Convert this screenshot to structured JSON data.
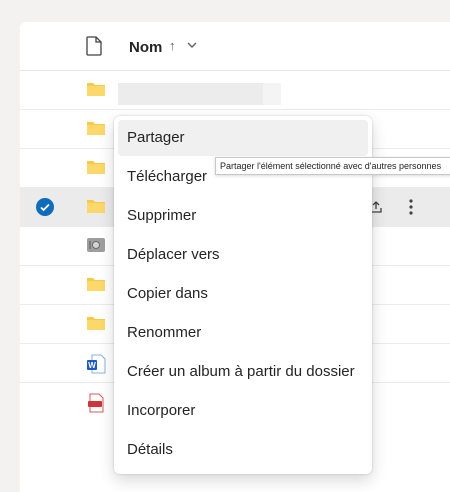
{
  "header": {
    "name_label": "Nom",
    "sort_arrow": "↑",
    "file_column_icon": "file-icon",
    "sort_menu_icon": "chevron-down-icon"
  },
  "rows": [
    {
      "icon": "folder-icon",
      "selected": false
    },
    {
      "icon": "folder-icon",
      "selected": false
    },
    {
      "icon": "folder-icon",
      "selected": false
    },
    {
      "icon": "folder-icon",
      "selected": true
    },
    {
      "icon": "vault-icon",
      "selected": false
    },
    {
      "icon": "folder-icon",
      "selected": false
    },
    {
      "icon": "folder-icon",
      "selected": false
    },
    {
      "icon": "word-doc-icon",
      "selected": false
    },
    {
      "icon": "pdf-icon",
      "selected": false
    }
  ],
  "row_actions": {
    "share_icon": "share-icon",
    "more_icon": "more-vertical-icon"
  },
  "context_menu": {
    "items": [
      "Partager",
      "Télécharger",
      "Supprimer",
      "Déplacer vers",
      "Copier dans",
      "Renommer",
      "Créer un album à partir du dossier",
      "Incorporer",
      "Détails"
    ],
    "hovered_index": 0
  },
  "tooltip": {
    "text": "Partager l'élément sélectionné avec d'autres personnes"
  },
  "colors": {
    "accent": "#0f6cbd",
    "folder": "#f7c948",
    "selected_row": "#ebebeb"
  }
}
